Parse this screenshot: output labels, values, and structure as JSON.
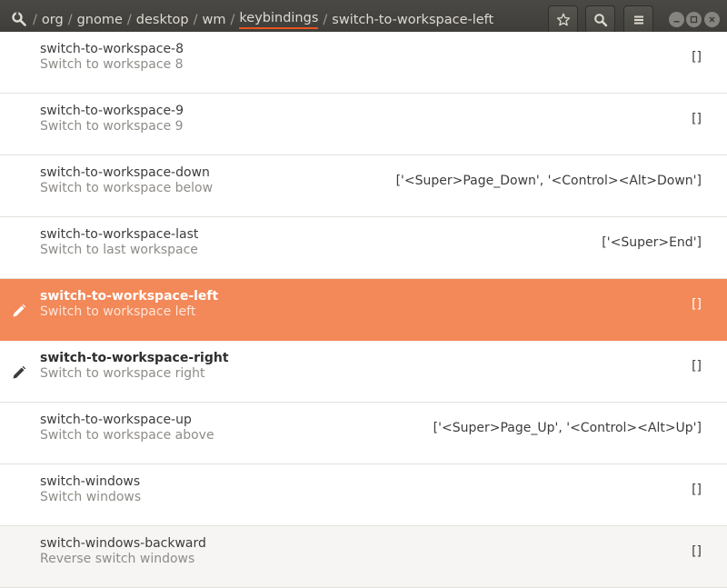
{
  "header": {
    "path": [
      "org",
      "gnome",
      "desktop",
      "wm",
      "keybindings",
      "switch-to-workspace-left"
    ],
    "separator": "/",
    "leading_separator": "/",
    "buttons": [
      {
        "name": "bookmark-button",
        "icon": "star-icon"
      },
      {
        "name": "search-button",
        "icon": "search-icon"
      },
      {
        "name": "menu-button",
        "icon": "hamburger-menu-icon"
      }
    ],
    "window_controls": [
      "minimize",
      "maximize",
      "close"
    ]
  },
  "keys": [
    {
      "name": "switch-to-workspace-8",
      "summary": "Switch to workspace 8",
      "value": "[]"
    },
    {
      "name": "switch-to-workspace-9",
      "summary": "Switch to workspace 9",
      "value": "[]"
    },
    {
      "name": "switch-to-workspace-down",
      "summary": "Switch to workspace below",
      "value": "['<Super>Page_Down', '<Control><Alt>Down']"
    },
    {
      "name": "switch-to-workspace-last",
      "summary": "Switch to last workspace",
      "value": "['<Super>End']"
    },
    {
      "name": "switch-to-workspace-left",
      "summary": "Switch to workspace left",
      "value": "[]"
    },
    {
      "name": "switch-to-workspace-right",
      "summary": "Switch to workspace right",
      "value": "[]"
    },
    {
      "name": "switch-to-workspace-up",
      "summary": "Switch to workspace above",
      "value": "['<Super>Page_Up', '<Control><Alt>Up']"
    },
    {
      "name": "switch-windows",
      "summary": "Switch windows",
      "value": "[]"
    },
    {
      "name": "switch-windows-backward",
      "summary": "Reverse switch windows",
      "value": "[]"
    }
  ],
  "colors": {
    "accent": "#e95420",
    "selected_row": "#f38858",
    "header_bg": "#3c3b37"
  }
}
